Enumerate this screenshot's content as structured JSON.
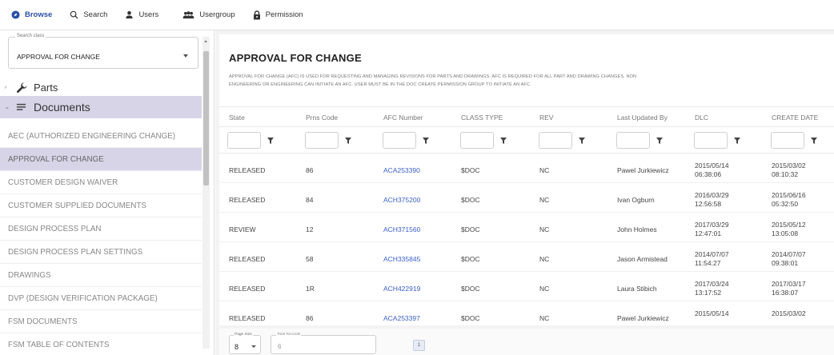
{
  "nav": {
    "items": [
      {
        "label": "Browse",
        "icon": "compass-icon"
      },
      {
        "label": "Search",
        "icon": "search-icon"
      },
      {
        "label": "Users",
        "icon": "user-icon"
      },
      {
        "label": "Usergroup",
        "icon": "usergroup-icon"
      },
      {
        "label": "Permission",
        "icon": "lock-icon"
      }
    ],
    "active_color": "#2b4fa8"
  },
  "sidebar": {
    "search_class": {
      "label": "Search class",
      "value": "APPROVAL FOR CHANGE"
    },
    "tree": {
      "parts_label": "Parts",
      "documents_label": "Documents"
    },
    "items": [
      {
        "label": "AEC (AUTHORIZED ENGINEERING CHANGE)"
      },
      {
        "label": "APPROVAL FOR CHANGE"
      },
      {
        "label": "CUSTOMER DESIGN WAIVER"
      },
      {
        "label": "CUSTOMER SUPPLIED DOCUMENTS"
      },
      {
        "label": "DESIGN PROCESS PLAN"
      },
      {
        "label": "DESIGN PROCESS PLAN SETTINGS"
      },
      {
        "label": "DRAWINGS"
      },
      {
        "label": "DVP (DESIGN VERIFICATION PACKAGE)"
      },
      {
        "label": "FSM DOCUMENTS"
      },
      {
        "label": "FSM TABLE OF CONTENTS"
      }
    ],
    "selected_color": "#d8d4e8"
  },
  "main": {
    "title": "APPROVAL FOR CHANGE",
    "description_line1": "APPROVAL FOR CHANGE (AFC) IS USED FOR REQUESTING AND MANAGING REVISIONS FOR PARTS AND DRAWINGS. AFC IS REQUIRED FOR ALL PART AND DRAWING CHANGES. NON",
    "description_line2": "ENGINEERING OR ENGINEERING CAN INITIATE AN AFC. USER MUST BE IN THE DOC CREATE PERMISSION GROUP TO INITIATE AN AFC.",
    "columns": [
      "State",
      "Prns Code",
      "AFC Number",
      "CLASS TYPE",
      "REV",
      "Last Updated By",
      "DLC",
      "CREATE DATE"
    ],
    "rows": [
      {
        "state": "RELEASED",
        "prns": "86",
        "afc": "ACA253390",
        "class_type": "$DOC",
        "rev": "NC",
        "updated_by": "Pawel Jurkiewicz",
        "dlc_date": "2015/05/14",
        "dlc_time": "06:38:06",
        "create_date": "2015/03/02",
        "create_time": "08:10:32"
      },
      {
        "state": "RELEASED",
        "prns": "84",
        "afc": "ACH375200",
        "class_type": "$DOC",
        "rev": "NC",
        "updated_by": "Ivan Ogburn",
        "dlc_date": "2016/03/29",
        "dlc_time": "12:56:58",
        "create_date": "2015/06/16",
        "create_time": "05:32:50"
      },
      {
        "state": "REVIEW",
        "prns": "12",
        "afc": "ACH371560",
        "class_type": "$DOC",
        "rev": "NC",
        "updated_by": "John Holmes",
        "dlc_date": "2017/03/29",
        "dlc_time": "12:47:01",
        "create_date": "2015/05/12",
        "create_time": "13:05:08"
      },
      {
        "state": "RELEASED",
        "prns": "58",
        "afc": "ACH335845",
        "class_type": "$DOC",
        "rev": "NC",
        "updated_by": "Jason Armistead",
        "dlc_date": "2014/07/07",
        "dlc_time": "11:54:27",
        "create_date": "2014/07/07",
        "create_time": "09:38:01"
      },
      {
        "state": "RELEASED",
        "prns": "1R",
        "afc": "ACH422919",
        "class_type": "$DOC",
        "rev": "NC",
        "updated_by": "Laura Stibich",
        "dlc_date": "2017/03/24",
        "dlc_time": "13:17:52",
        "create_date": "2017/03/17",
        "create_time": "16:38:07"
      },
      {
        "state": "RELEASED",
        "prns": "86",
        "afc": "ACA253397",
        "class_type": "$DOC",
        "rev": "NC",
        "updated_by": "Pawel Jurkiewicz",
        "dlc_date": "2015/05/14",
        "dlc_time": "",
        "create_date": "2015/03/02",
        "create_time": ""
      }
    ],
    "link_color": "#3a5fc8"
  },
  "pager": {
    "page_size_label": "Page Size",
    "page_size_value": "8",
    "total_label": "Total Records",
    "total_value": "6",
    "current_page": "1"
  }
}
